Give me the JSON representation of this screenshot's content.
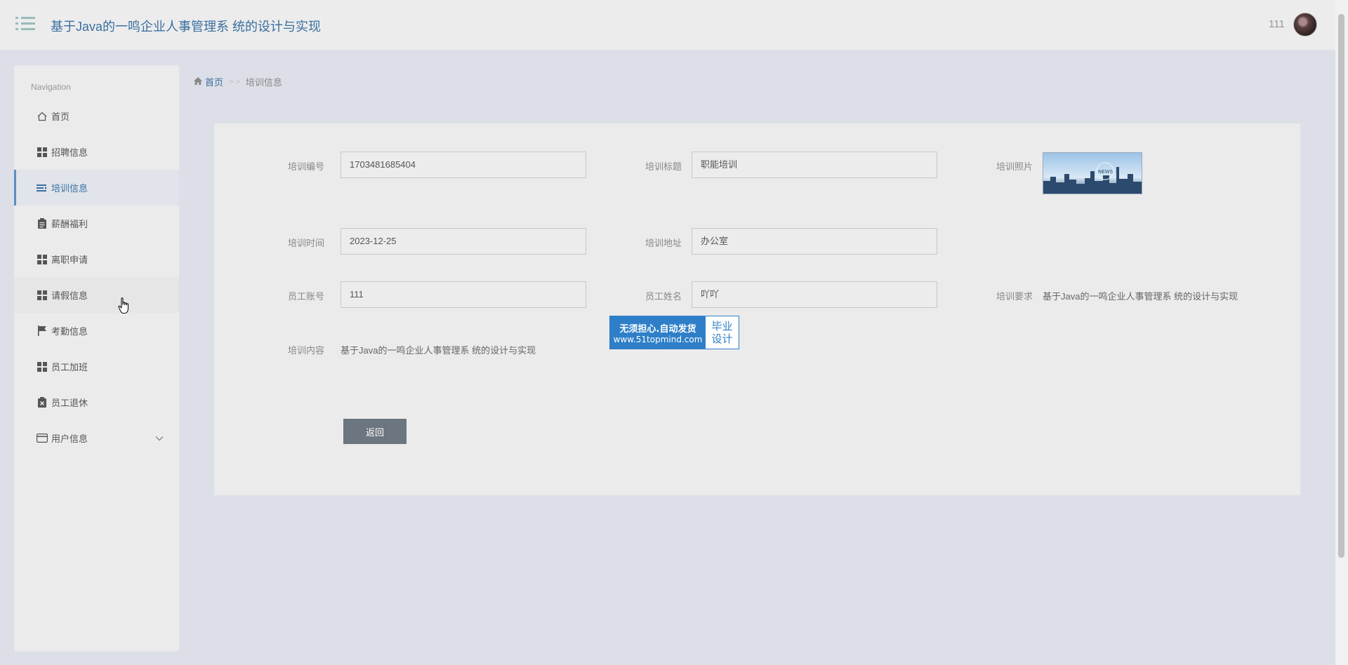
{
  "header": {
    "title": "基于Java的一鸣企业人事管理系 统的设计与实现",
    "user_name": "111"
  },
  "sidebar": {
    "heading": "Navigation",
    "items": [
      {
        "label": "首页",
        "icon": "home-icon"
      },
      {
        "label": "招聘信息",
        "icon": "grid-icon"
      },
      {
        "label": "培训信息",
        "icon": "list-icon",
        "active": true
      },
      {
        "label": "薪酬福利",
        "icon": "clipboard-icon"
      },
      {
        "label": "离职申请",
        "icon": "grid-icon"
      },
      {
        "label": "请假信息",
        "icon": "grid-icon"
      },
      {
        "label": "考勤信息",
        "icon": "flag-icon"
      },
      {
        "label": "员工加班",
        "icon": "grid-icon"
      },
      {
        "label": "员工退休",
        "icon": "clipboard-x-icon"
      },
      {
        "label": "用户信息",
        "icon": "card-icon",
        "has_submenu": true
      }
    ]
  },
  "breadcrumb": {
    "home": "首页",
    "separator": "> >",
    "current": "培训信息"
  },
  "form": {
    "training_no": {
      "label": "培训编号",
      "value": "1703481685404"
    },
    "training_title": {
      "label": "培训标题",
      "value": "职能培训"
    },
    "training_photo": {
      "label": "培训照片",
      "image_text": "NEWS"
    },
    "training_time": {
      "label": "培训时间",
      "value": "2023-12-25"
    },
    "training_address": {
      "label": "培训地址",
      "value": "办公室"
    },
    "employee_account": {
      "label": "员工账号",
      "value": "111"
    },
    "employee_name": {
      "label": "员工姓名",
      "value": "吖吖"
    },
    "training_requirement": {
      "label": "培训要求",
      "value": "基于Java的一鸣企业人事管理系 统的设计与实现"
    },
    "training_content": {
      "label": "培训内容",
      "value": "基于Java的一鸣企业人事管理系 统的设计与实现"
    },
    "back_button": "返回"
  },
  "watermark": {
    "line1": "无须担心.自动发货",
    "line2": "www.51topmind.com",
    "right_top": "毕业",
    "right_bottom": "设计"
  },
  "colors": {
    "accent": "#3a6fa0",
    "page_bg": "#dcdfe7",
    "panel_bg": "#ebebeb",
    "button_bg": "#6c7680",
    "watermark_blue": "#2e7fc7"
  }
}
